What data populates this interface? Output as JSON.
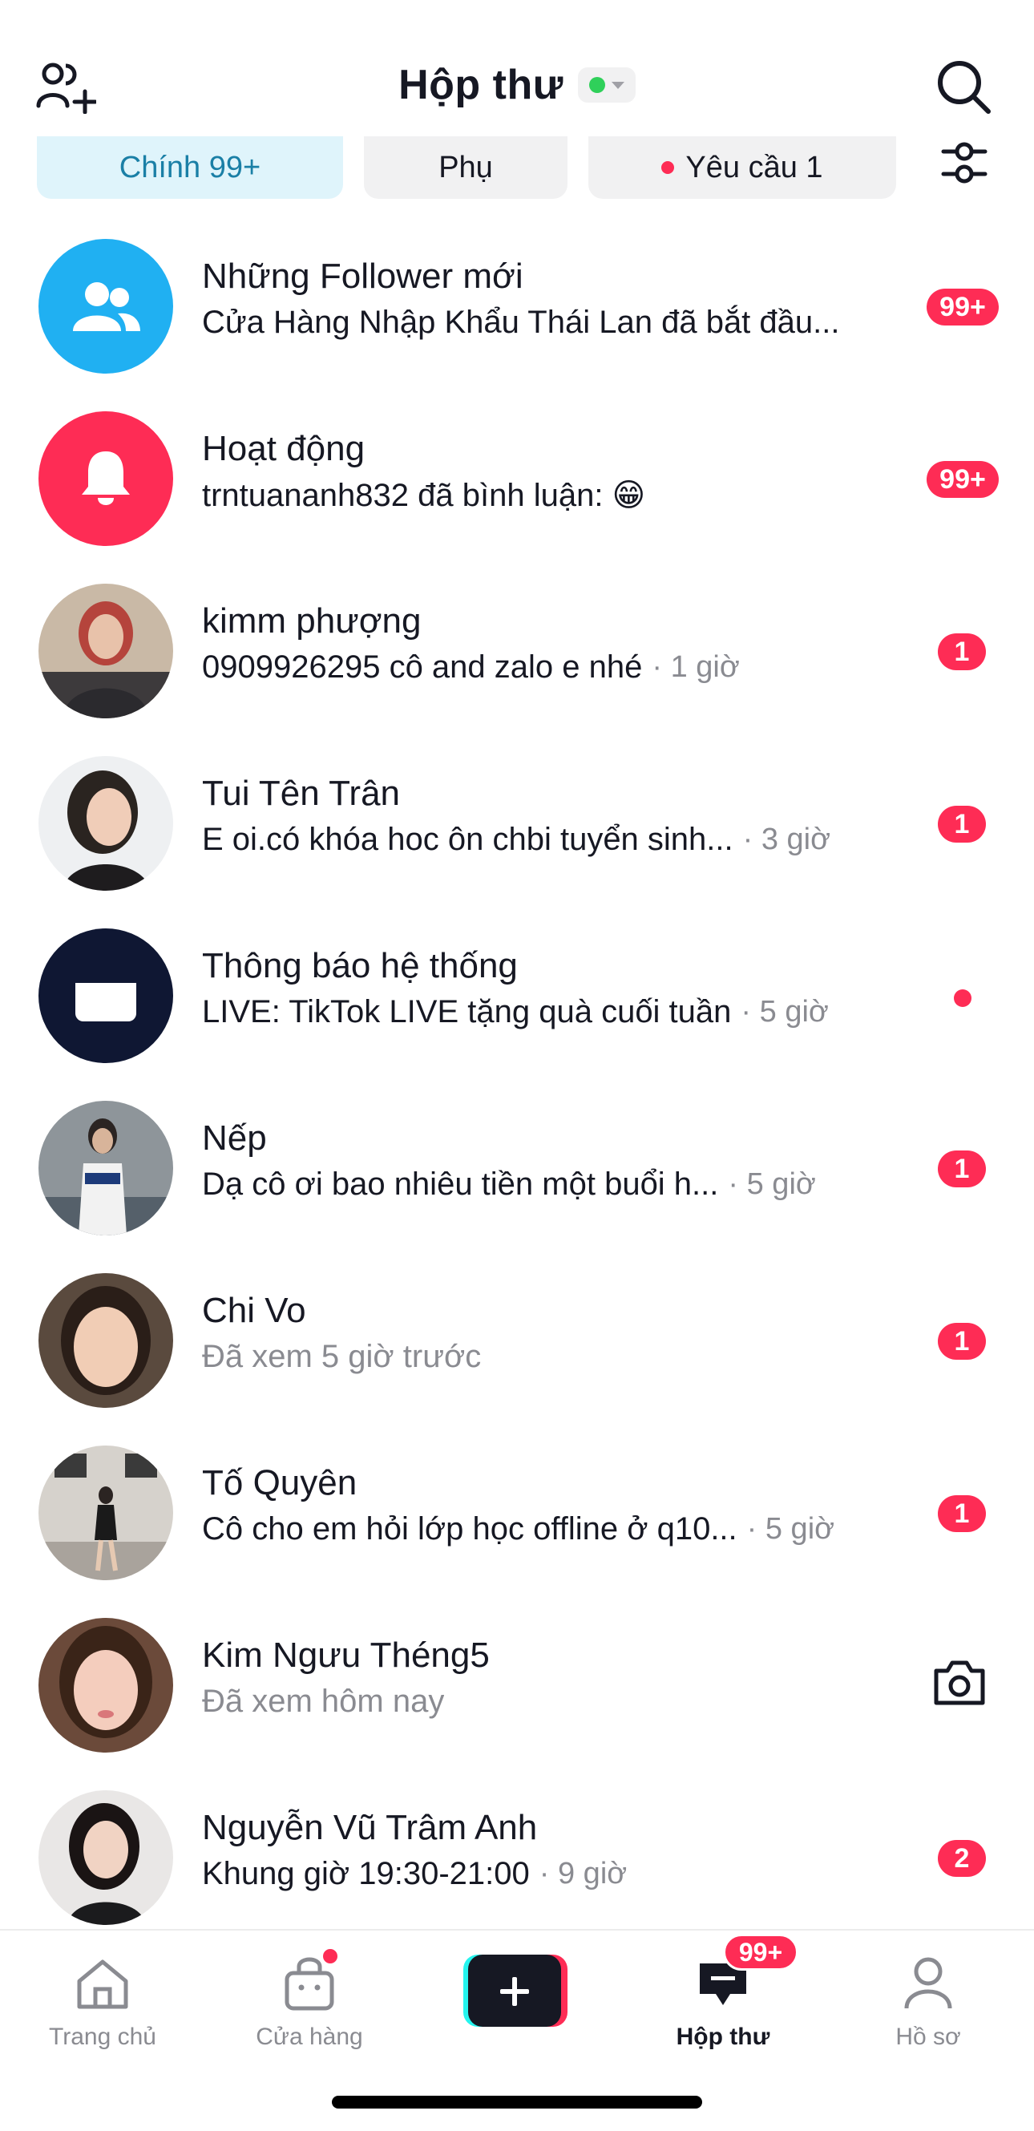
{
  "header": {
    "title": "Hộp thư",
    "status_color": "#2fd05a"
  },
  "tabs": [
    {
      "label": "Chính 99+",
      "active": true
    },
    {
      "label": "Phụ",
      "active": false
    },
    {
      "label": "Yêu cầu 1",
      "active": false,
      "dot": true
    }
  ],
  "conversations": [
    {
      "name": "Những Follower mới",
      "message": "Cửa Hàng Nhập Khẩu Thái Lan đã bắt đầu...",
      "time": "",
      "badge": "99+",
      "avatar_icon": "followers-icon",
      "avatar_color": "#20b0f2"
    },
    {
      "name": "Hoạt động",
      "message": "trntuananh832 đã bình luận: 😁",
      "time": "",
      "badge": "99+",
      "avatar_icon": "bell-icon",
      "avatar_color": "#fe2c55"
    },
    {
      "name": "kimm phượng",
      "message": "0909926295 cô and zalo e nhé",
      "time": "· 1 giờ",
      "badge": "1"
    },
    {
      "name": "Tui Tên Trân",
      "message": "E oi.có khóa hoc ôn chbi tuyển sinh...",
      "time": "· 3 giờ",
      "badge": "1"
    },
    {
      "name": "Thông báo hệ thống",
      "message": "LIVE: TikTok LIVE tặng quà cuối tuần",
      "time": "· 5 giờ",
      "badge": "dot",
      "avatar_icon": "inbox-tray-icon",
      "avatar_color": "#0f1733"
    },
    {
      "name": "Nếp",
      "message": "Dạ cô ơi bao nhiêu tiền một buổi h...",
      "time": "· 5 giờ",
      "badge": "1"
    },
    {
      "name": "Chi Vo",
      "message": "Đã xem 5 giờ trước",
      "time": "",
      "badge": "1",
      "seen": true
    },
    {
      "name": "Tố Quyên",
      "message": "Cô cho em hỏi lớp học offline ở q10...",
      "time": "· 5 giờ",
      "badge": "1"
    },
    {
      "name": "Kim Ngưu Théng5",
      "message": "Đã xem hôm nay",
      "time": "",
      "badge": "camera",
      "seen": true
    },
    {
      "name": "Nguyễn Vũ Trâm Anh",
      "message": "Khung giờ 19:30-21:00",
      "time": "· 9 giờ",
      "badge": "2"
    }
  ],
  "tabbar": {
    "home": "Trang chủ",
    "shop": "Cửa hàng",
    "inbox": "Hộp thư",
    "inbox_badge": "99+",
    "profile": "Hồ sơ"
  },
  "colors": {
    "accent": "#fe2c55",
    "primary_tab_bg": "#dff4fb",
    "primary_tab_text": "#1a7fa6"
  }
}
